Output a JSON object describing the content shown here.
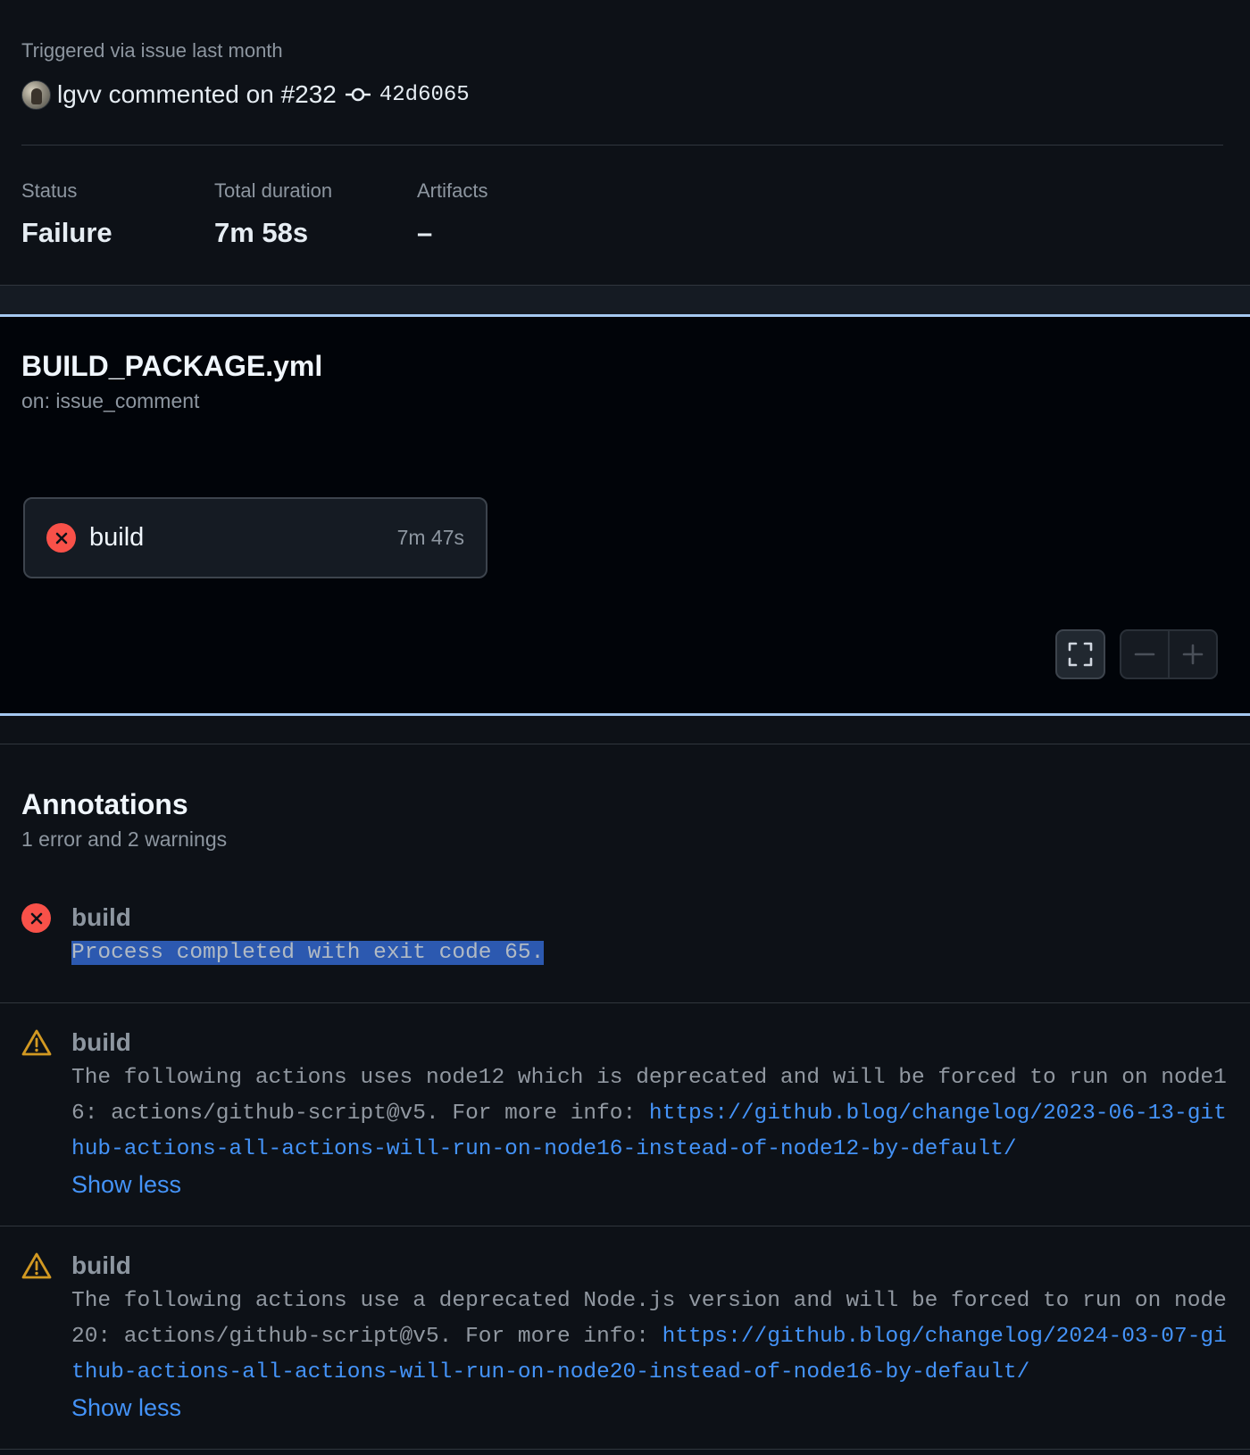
{
  "trigger": {
    "text": "Triggered via issue last month",
    "actor_line": "lgvv commented on #232",
    "commit_sha": "42d6065"
  },
  "stats": [
    {
      "label": "Status",
      "value": "Failure"
    },
    {
      "label": "Total duration",
      "value": "7m 58s"
    },
    {
      "label": "Artifacts",
      "value": "–"
    }
  ],
  "workflow": {
    "title": "BUILD_PACKAGE.yml",
    "subtitle": "on: issue_comment",
    "job": {
      "name": "build",
      "duration": "7m 47s",
      "status": "failure"
    }
  },
  "annotations": {
    "title": "Annotations",
    "summary": "1 error and 2 warnings",
    "items": [
      {
        "type": "error",
        "job": "build",
        "message": "Process completed with exit code 65."
      },
      {
        "type": "warning",
        "job": "build",
        "message_prefix": "The following actions uses node12 which is deprecated and will be forced to run on node16: actions/github-script@v5. For more info: ",
        "link": "https://github.blog/changelog/2023-06-13-github-actions-all-actions-will-run-on-node16-instead-of-node12-by-default/",
        "toggle": "Show less"
      },
      {
        "type": "warning",
        "job": "build",
        "message_prefix": "The following actions use a deprecated Node.js version and will be forced to run on node20: actions/github-script@v5. For more info: ",
        "link": "https://github.blog/changelog/2024-03-07-github-actions-all-actions-will-run-on-node20-instead-of-node16-by-default/",
        "toggle": "Show less"
      }
    ]
  },
  "colors": {
    "background": "#0d1117",
    "error": "#f85149",
    "warning": "#d29922",
    "link": "#4493f8",
    "focus_border": "#a5c8f0"
  },
  "icons": [
    "commit-icon",
    "x-circle-icon",
    "warning-icon",
    "fullscreen-icon",
    "zoom-out-icon",
    "zoom-in-icon"
  ]
}
